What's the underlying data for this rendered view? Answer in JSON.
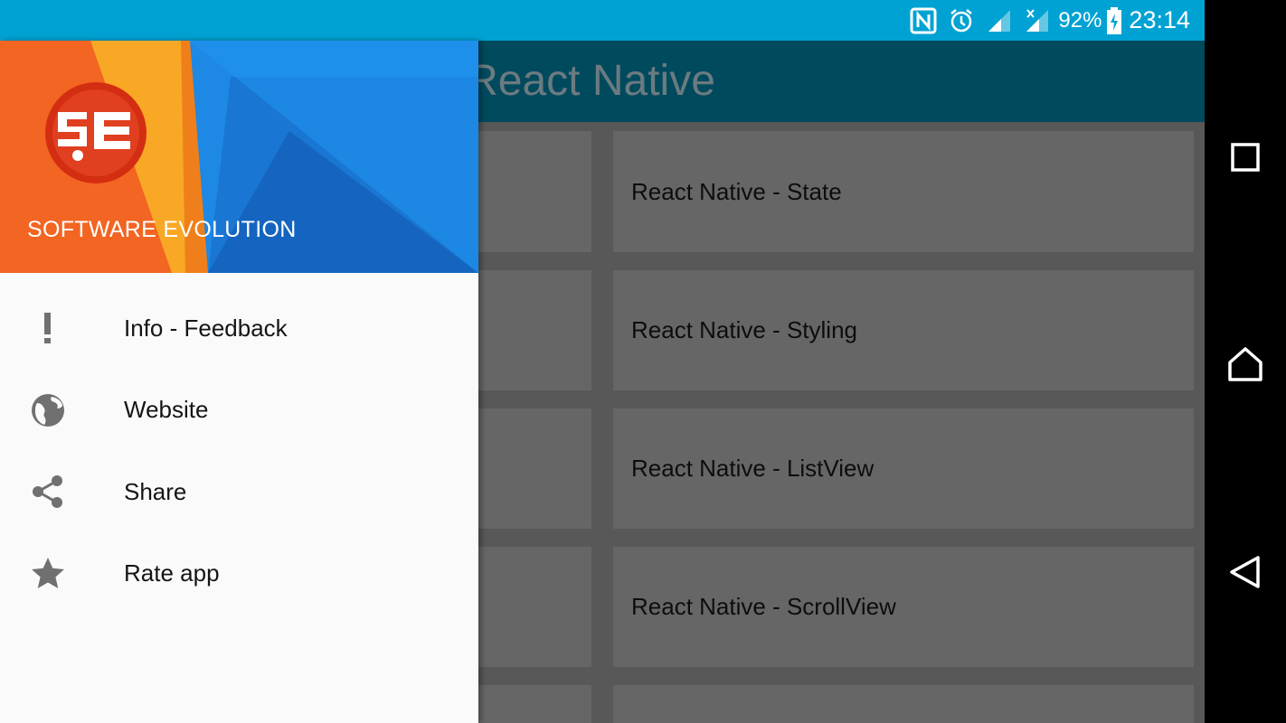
{
  "status_bar": {
    "battery": "92%",
    "time": "23:14",
    "icons": [
      "nfc-icon",
      "alarm-icon",
      "signal-icon",
      "signal-no-data-icon",
      "battery-charging-icon"
    ]
  },
  "app_bar": {
    "title": "Learn React Native"
  },
  "grid": {
    "items": [
      "React Native - State",
      "React Native - Styling",
      "React Native - ListView",
      "React Native - ScrollView"
    ]
  },
  "drawer": {
    "brand": "SOFTWARE EVOLUTION",
    "logo_text": "SE",
    "items": [
      {
        "label": "Info - Feedback",
        "icon": "exclamation-icon"
      },
      {
        "label": "Website",
        "icon": "globe-icon"
      },
      {
        "label": "Share",
        "icon": "share-icon"
      },
      {
        "label": "Rate app",
        "icon": "star-icon"
      }
    ]
  },
  "nav_bar": {
    "buttons": [
      "recents-button",
      "home-button",
      "back-button"
    ]
  },
  "colors": {
    "status_bar": "#00a2d3",
    "app_bar": "#004a5e",
    "drawer_bg": "#fafafa",
    "header_orange": "#f26522",
    "header_blue": "#1e88e5"
  }
}
